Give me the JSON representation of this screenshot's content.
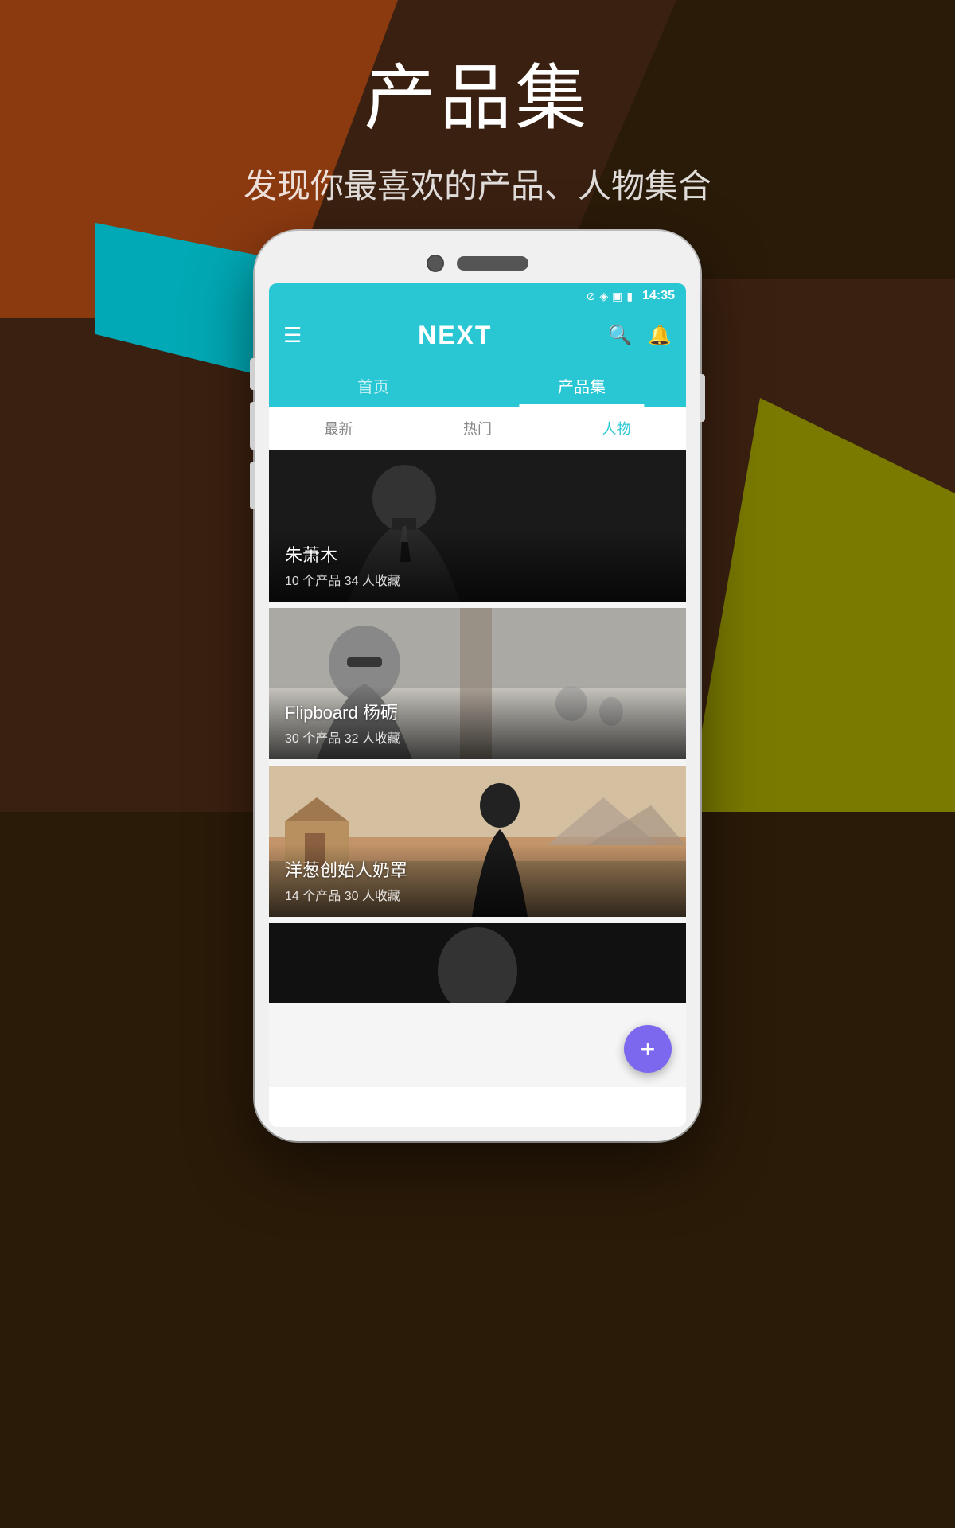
{
  "page": {
    "title": "产品集",
    "subtitle": "发现你最喜欢的产品、人物集合"
  },
  "app": {
    "name": "NEXT",
    "status_time": "14:35"
  },
  "main_tabs": [
    {
      "label": "首页",
      "active": false
    },
    {
      "label": "产品集",
      "active": true
    }
  ],
  "sub_tabs": [
    {
      "label": "最新",
      "active": false
    },
    {
      "label": "热门",
      "active": false
    },
    {
      "label": "人物",
      "active": true
    }
  ],
  "cards": [
    {
      "title": "朱萧木",
      "meta": "10 个产品 34 人收藏",
      "theme": "dark"
    },
    {
      "title": "Flipboard 杨砺",
      "meta": "30 个产品 32 人收藏",
      "theme": "gray"
    },
    {
      "title": "洋葱创始人奶罩",
      "meta": "14 个产品 30 人收藏",
      "theme": "warm"
    },
    {
      "title": "",
      "meta": "",
      "theme": "dark"
    }
  ],
  "fab": {
    "label": "+",
    "color": "#7b68ee"
  },
  "status_bar": {
    "time": "14:35",
    "icons": [
      "⊘",
      "◈",
      "▣",
      "🔋"
    ]
  }
}
